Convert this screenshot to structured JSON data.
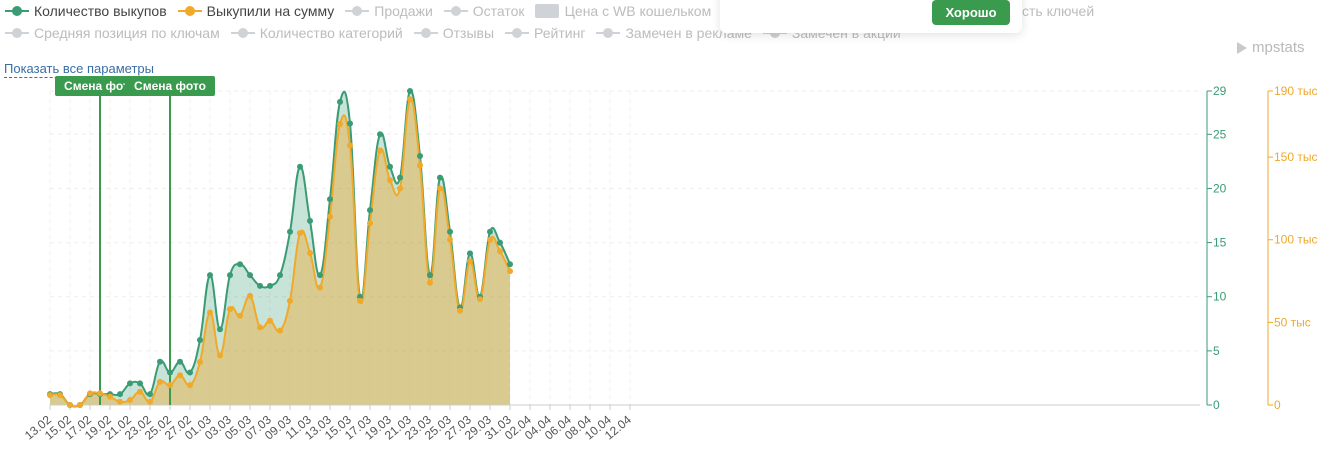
{
  "legend": {
    "row1": [
      {
        "label": "Количество выкупов",
        "active": true,
        "color": "#3a9b74"
      },
      {
        "label": "Выкупили на сумму",
        "active": true,
        "color": "#f0a92a"
      },
      {
        "label": "Продажи",
        "active": false
      },
      {
        "label": "Остаток",
        "active": false
      },
      {
        "label": "Цена с WB кошельком",
        "active": false,
        "rect": true
      }
    ],
    "row1_tail": "сть ключей",
    "row2": [
      {
        "label": "Средняя позиция по ключам",
        "active": false
      },
      {
        "label": "Количество категорий",
        "active": false
      },
      {
        "label": "Отзывы",
        "active": false
      },
      {
        "label": "Рейтинг",
        "active": false
      },
      {
        "label": "Замечен в рекламе",
        "active": false
      },
      {
        "label": "Замечен в акции",
        "active": false
      }
    ]
  },
  "show_all_label": "Показать все параметры",
  "logo_text": "mpstats",
  "popup": {
    "button_label": "Хорошо"
  },
  "chart_data": {
    "type": "area",
    "x": [
      "13.02",
      "14.02",
      "15.02",
      "16.02",
      "17.02",
      "18.02",
      "19.02",
      "20.02",
      "21.02",
      "22.02",
      "23.02",
      "24.02",
      "25.02",
      "26.02",
      "27.02",
      "28.02",
      "01.03",
      "02.03",
      "03.03",
      "04.03",
      "05.03",
      "06.03",
      "07.03",
      "08.03",
      "09.03",
      "10.03",
      "11.03",
      "12.03",
      "13.03",
      "14.03",
      "15.03",
      "16.03",
      "17.03",
      "18.03",
      "19.03",
      "20.03",
      "21.03",
      "22.03",
      "23.03",
      "24.03",
      "25.03",
      "26.03",
      "27.03",
      "28.03",
      "29.03",
      "30.03",
      "31.03",
      "01.04",
      "02.04",
      "03.04",
      "04.04",
      "05.04",
      "06.04",
      "07.04",
      "08.04",
      "09.04",
      "10.04",
      "11.04",
      "12.04"
    ],
    "x_tick_labels": [
      "13.02",
      "15.02",
      "17.02",
      "19.02",
      "21.02",
      "23.02",
      "25.02",
      "27.02",
      "01.03",
      "03.03",
      "05.03",
      "07.03",
      "09.03",
      "11.03",
      "13.03",
      "15.03",
      "17.03",
      "19.03",
      "21.03",
      "23.03",
      "25.03",
      "27.03",
      "29.03",
      "31.03",
      "02.04",
      "04.04",
      "06.04",
      "08.04",
      "10.04",
      "12.04"
    ],
    "series": [
      {
        "name": "Количество выкупов",
        "axis": "left",
        "color": "#3a9b74",
        "values": [
          1,
          1,
          0,
          0,
          1,
          1,
          1,
          1,
          2,
          2,
          1,
          4,
          3,
          4,
          3,
          6,
          12,
          7,
          12,
          13,
          12,
          11,
          11,
          12,
          16,
          22,
          17,
          12,
          19,
          28,
          26,
          10,
          18,
          25,
          22,
          21,
          29,
          23,
          12,
          21,
          16,
          9,
          14,
          10,
          16,
          15,
          13
        ]
      },
      {
        "name": "Выкупили на сумму",
        "axis": "right",
        "color": "#f0a92a",
        "values": [
          6000,
          6000,
          0,
          0,
          7000,
          7000,
          5000,
          2000,
          3000,
          8000,
          2000,
          14000,
          12000,
          18000,
          12000,
          26000,
          56000,
          30000,
          58000,
          54000,
          66000,
          47000,
          51000,
          45000,
          63000,
          104000,
          92000,
          71000,
          114000,
          170000,
          157000,
          63000,
          110000,
          154000,
          136000,
          131000,
          185000,
          145000,
          74000,
          131000,
          100000,
          57000,
          87000,
          64000,
          100000,
          93000,
          81000
        ]
      }
    ],
    "y_left": {
      "min": 0,
      "max": 29,
      "ticks": [
        0,
        5,
        10,
        15,
        20,
        25,
        29
      ]
    },
    "y_right": {
      "min": 0,
      "max": 190000,
      "ticks": [
        0,
        50000,
        100000,
        150000,
        190000
      ],
      "tick_labels": [
        "0",
        "50 тыс",
        "100 тыс",
        "150 тыс",
        "190 тыс"
      ]
    },
    "annotations": [
      {
        "date": "18.02",
        "label": "Смена фото"
      },
      {
        "date": "25.02",
        "label": "Смена фото"
      }
    ],
    "grid": true
  }
}
